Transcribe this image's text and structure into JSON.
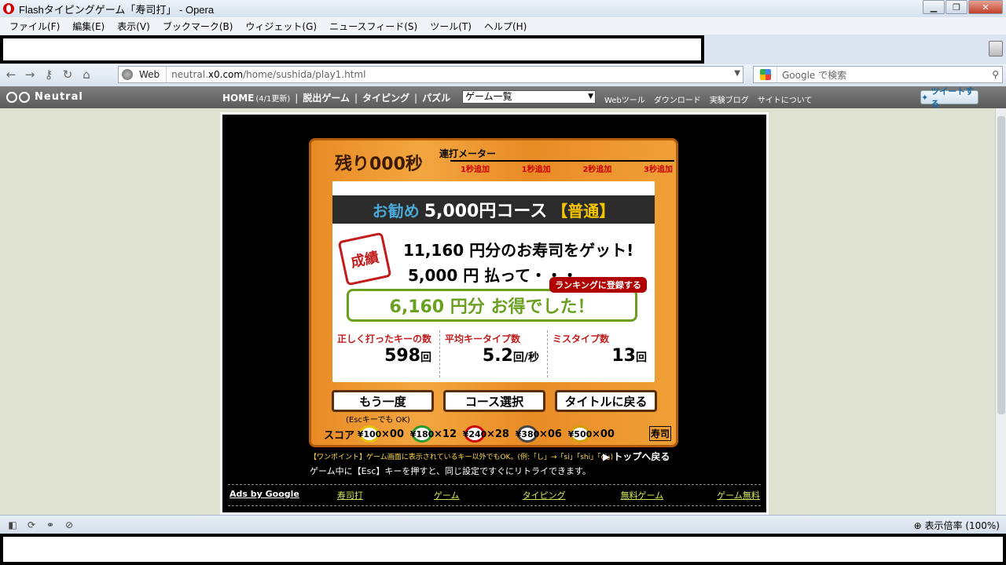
{
  "window": {
    "title": "Flashタイピングゲーム「寿司打」 - Opera"
  },
  "menu": [
    "ファイル(F)",
    "編集(E)",
    "表示(V)",
    "ブックマーク(B)",
    "ウィジェット(G)",
    "ニュースフィード(S)",
    "ツール(T)",
    "ヘルプ(H)"
  ],
  "address": {
    "mode": "Web",
    "url_prefix": "neutral.",
    "url_host": "x0.com",
    "url_path": "/home/sushida/play1.html"
  },
  "search": {
    "placeholder": "Google で検索"
  },
  "site": {
    "logo": "Neutral",
    "nav_home": "HOME",
    "nav_home_note": "(4/1更新)",
    "nav_escape": "脱出ゲーム",
    "nav_typing": "タイピング",
    "nav_puzzle": "パズル",
    "select_value": "ゲーム一覧",
    "links": [
      "Webツール",
      "ダウンロード",
      "実験ブログ",
      "サイトについて"
    ],
    "tweet": "ツイートする"
  },
  "game": {
    "timer": "残り000秒",
    "meter_title": "連打メーター",
    "meter_marks": [
      "1秒追加",
      "1秒追加",
      "2秒追加",
      "3秒追加"
    ],
    "course_rec": "お勧め",
    "course_price": "5,000円コース",
    "course_level": "【普通】",
    "stamp": "成績",
    "got": "11,160 円分のお寿司をゲット!",
    "paid": "5,000 円 払って・・・",
    "rank_button": "ランキングに登録する",
    "saved": "6,160 円分 お得でした！",
    "stats": [
      {
        "label": "正しく打ったキーの数",
        "value": "598",
        "unit": "回"
      },
      {
        "label": "平均キータイプ数",
        "value": "5.2",
        "unit": "回/秒"
      },
      {
        "label": "ミスタイプ数",
        "value": "13",
        "unit": "回"
      }
    ],
    "btn_retry": "もう一度",
    "btn_course": "コース選択",
    "btn_title": "タイトルに戻る",
    "esc_note": "(Escキーでも OK)",
    "score_label": "スコア",
    "plates": [
      {
        "price": "¥100",
        "count": "×00"
      },
      {
        "price": "¥180",
        "count": "×12"
      },
      {
        "price": "¥240",
        "count": "×28"
      },
      {
        "price": "¥380",
        "count": "×06"
      },
      {
        "price": "¥500",
        "count": "×00"
      }
    ],
    "brand_stamp": "寿司"
  },
  "hint": "【ワンポイント】ゲーム画面に表示されているキー以外でもOK。(例:「し」→「si」「shi」「ci」)",
  "top_link": "▶ トップへ戻る",
  "retry_note": "ゲーム中に【Esc】キーを押すと、同じ設定ですぐにリトライできます。",
  "ads": {
    "title": "Ads by Google",
    "links": [
      "寿司打",
      "ゲーム",
      "タイピング",
      "無料ゲーム",
      "ゲーム無料"
    ]
  },
  "status": {
    "zoom": "表示倍率 (100%)"
  }
}
